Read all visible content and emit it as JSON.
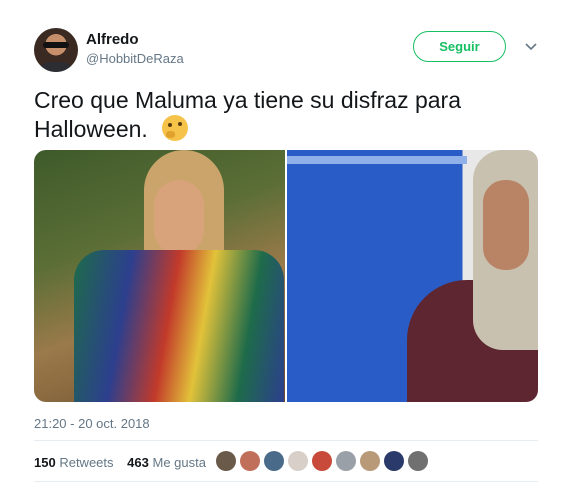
{
  "tweet": {
    "author_name": "Alfredo",
    "author_handle": "@HobbitDeRaza",
    "follow_label": "Seguir",
    "text": "Creo que Maluma ya tiene su disfraz para Halloween.",
    "emoji": "thinking-face",
    "timestamp": "21:20 - 20 oct. 2018",
    "retweets_count": "150",
    "retweets_label": "Retweets",
    "likes_count": "463",
    "likes_label": "Me gusta",
    "liker_avatar_colors": [
      "#6a5a4a",
      "#c0705a",
      "#4a6a8a",
      "#d8d0c8",
      "#c84a3a",
      "#9aa0a8",
      "#b89a78",
      "#2a3a6a",
      "#707070"
    ]
  },
  "colors": {
    "accent_green": "#17bf63",
    "secondary_text": "#657786",
    "divider": "#e6ecf0"
  }
}
